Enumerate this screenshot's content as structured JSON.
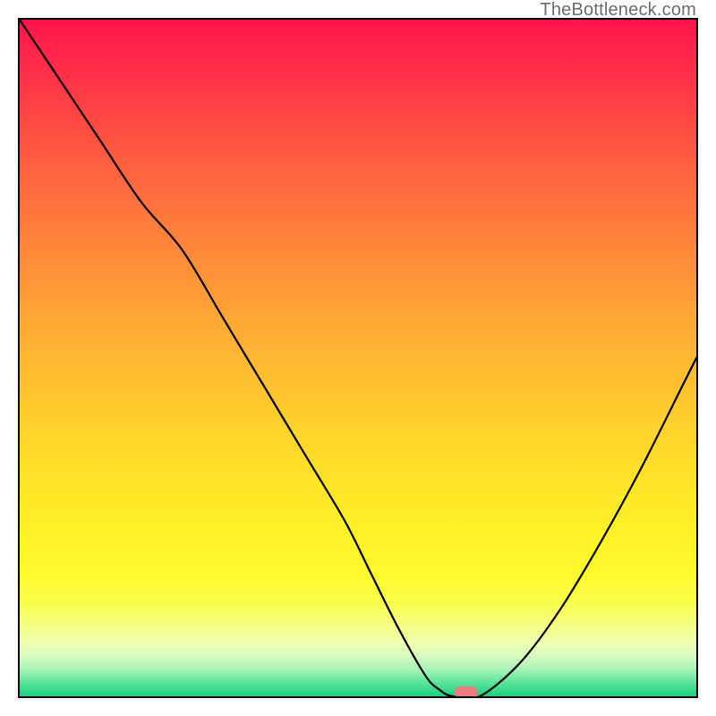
{
  "watermark": "TheBottleneck.com",
  "chart_data": {
    "type": "line",
    "x_range": [
      0,
      100
    ],
    "y_range": [
      0,
      100
    ],
    "title": "",
    "xlabel": "",
    "ylabel": "",
    "grid": false,
    "series": [
      {
        "name": "bottleneck-curve",
        "x": [
          0,
          6,
          12,
          18,
          24,
          30,
          36,
          42,
          48,
          52,
          56,
          60,
          62,
          64,
          68,
          74,
          80,
          86,
          92,
          98,
          100
        ],
        "y": [
          100,
          91,
          82,
          73,
          66,
          56,
          46,
          36,
          26,
          18,
          10,
          3,
          1,
          0,
          0,
          5,
          13,
          23,
          34,
          46,
          50
        ]
      }
    ],
    "marker": {
      "x": 66,
      "y": 0.5,
      "color": "#ed7b7c"
    },
    "background_gradient": {
      "type": "vertical",
      "stops": [
        {
          "pos": 0.0,
          "color": "#ff1449"
        },
        {
          "pos": 0.5,
          "color": "#ffb833"
        },
        {
          "pos": 0.8,
          "color": "#fff728"
        },
        {
          "pos": 1.0,
          "color": "#19d07f"
        }
      ]
    }
  }
}
